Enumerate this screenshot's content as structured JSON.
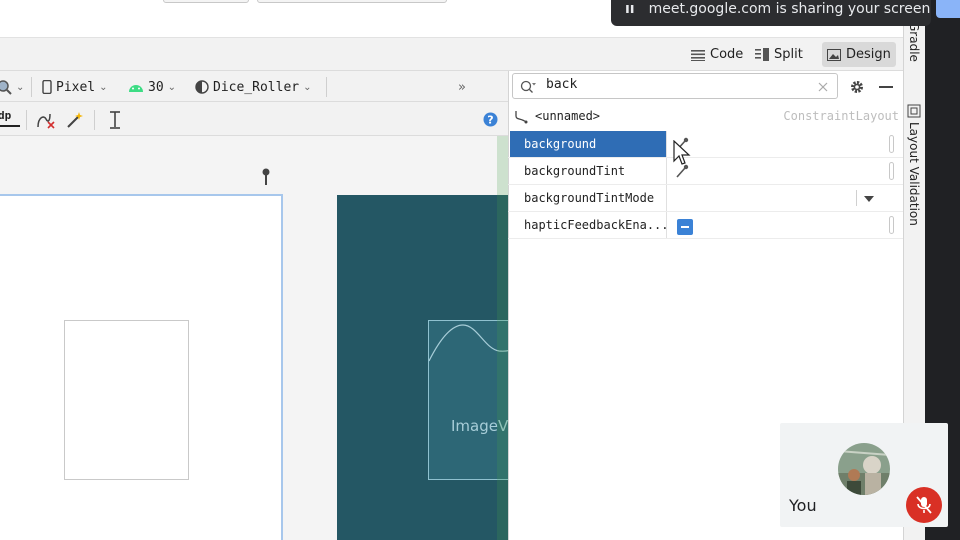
{
  "meet": {
    "banner_text": "meet.google.com is sharing your screen.",
    "self_label": "You"
  },
  "view_modes": [
    {
      "label": "Code",
      "icon": "code-view-icon"
    },
    {
      "label": "Split",
      "icon": "split-view-icon"
    },
    {
      "label": "Design",
      "icon": "design-view-icon",
      "active": true
    }
  ],
  "editor_toolbar": {
    "device": "Pixel",
    "api_level": "30",
    "theme": "Dice_Roller",
    "overflow": "»",
    "zoom_hint": "dp"
  },
  "attributes": {
    "search_value": "back",
    "component_name": "<unnamed>",
    "component_type": "ConstraintLayout",
    "rows": [
      {
        "name": "background",
        "selected": true
      },
      {
        "name": "backgroundTint"
      },
      {
        "name": "backgroundTintMode"
      },
      {
        "name": "hapticFeedbackEna..."
      }
    ]
  },
  "canvas": {
    "blueprint_label": "ImageVi"
  },
  "side_panels": [
    "Gradle",
    "Layout Validation"
  ],
  "colors": {
    "selection": "#2f6db5",
    "blueprint": "#245764",
    "warning": "#f4b400",
    "mic_off": "#d93025",
    "meet_banner": "#2c2d30"
  }
}
